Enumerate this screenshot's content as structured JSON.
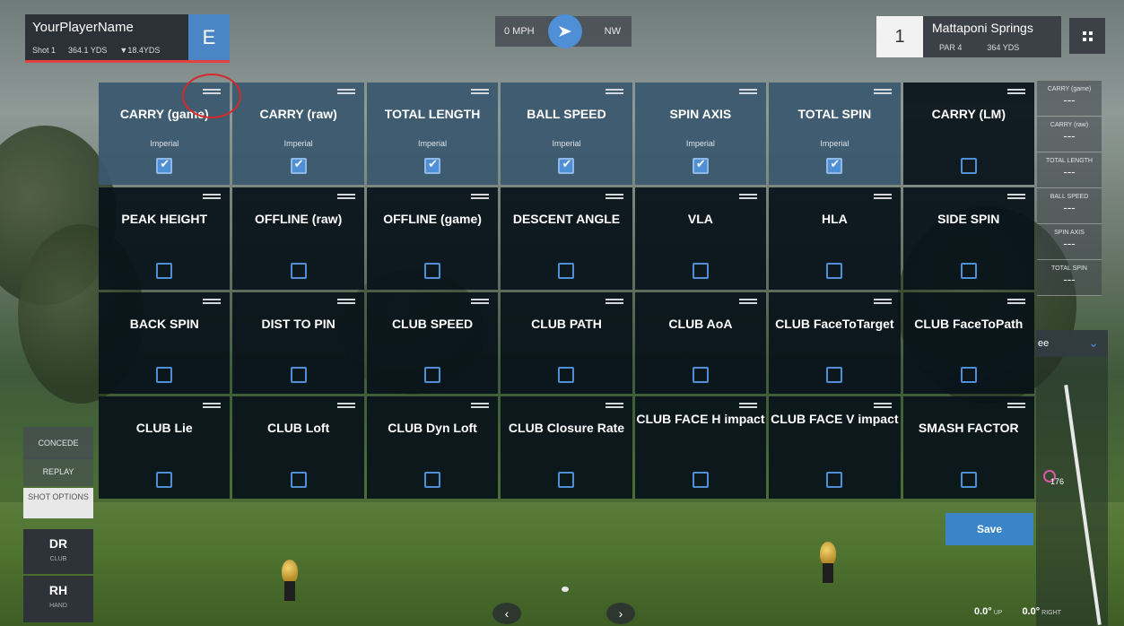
{
  "player": {
    "name": "YourPlayerName",
    "shot": "Shot 1",
    "distance": "364.1 YDS",
    "to_pin": "▼18.4YDS",
    "score": "E"
  },
  "wind": {
    "speed": "0 MPH",
    "direction": "NW"
  },
  "hole": {
    "number": "1",
    "course": "Mattaponi Springs",
    "par": "PAR 4",
    "yards": "364 YDS"
  },
  "stats": [
    {
      "label": "CARRY (game)",
      "value": "---"
    },
    {
      "label": "CARRY (raw)",
      "value": "---"
    },
    {
      "label": "TOTAL LENGTH",
      "value": "---"
    },
    {
      "label": "BALL SPEED",
      "value": "---"
    },
    {
      "label": "SPIN AXIS",
      "value": "---"
    },
    {
      "label": "TOTAL SPIN",
      "value": "---"
    }
  ],
  "tiles": [
    {
      "label": "CARRY (game)",
      "unit": "Imperial",
      "checked": true
    },
    {
      "label": "CARRY (raw)",
      "unit": "Imperial",
      "checked": true
    },
    {
      "label": "TOTAL LENGTH",
      "unit": "Imperial",
      "checked": true
    },
    {
      "label": "BALL SPEED",
      "unit": "Imperial",
      "checked": true
    },
    {
      "label": "SPIN AXIS",
      "unit": "Imperial",
      "checked": true
    },
    {
      "label": "TOTAL SPIN",
      "unit": "Imperial",
      "checked": true
    },
    {
      "label": "CARRY (LM)",
      "unit": "",
      "checked": false
    },
    {
      "label": "PEAK HEIGHT",
      "unit": "",
      "checked": false
    },
    {
      "label": "OFFLINE (raw)",
      "unit": "",
      "checked": false
    },
    {
      "label": "OFFLINE (game)",
      "unit": "",
      "checked": false
    },
    {
      "label": "DESCENT ANGLE",
      "unit": "",
      "checked": false
    },
    {
      "label": "VLA",
      "unit": "",
      "checked": false
    },
    {
      "label": "HLA",
      "unit": "",
      "checked": false
    },
    {
      "label": "SIDE SPIN",
      "unit": "",
      "checked": false
    },
    {
      "label": "BACK SPIN",
      "unit": "",
      "checked": false
    },
    {
      "label": "DIST TO PIN",
      "unit": "",
      "checked": false
    },
    {
      "label": "CLUB SPEED",
      "unit": "",
      "checked": false
    },
    {
      "label": "CLUB PATH",
      "unit": "",
      "checked": false
    },
    {
      "label": "CLUB AoA",
      "unit": "",
      "checked": false
    },
    {
      "label": "CLUB FaceToTarget",
      "unit": "",
      "checked": false
    },
    {
      "label": "CLUB FaceToPath",
      "unit": "",
      "checked": false
    },
    {
      "label": "CLUB Lie",
      "unit": "",
      "checked": false
    },
    {
      "label": "CLUB Loft",
      "unit": "",
      "checked": false
    },
    {
      "label": "CLUB Dyn Loft",
      "unit": "",
      "checked": false
    },
    {
      "label": "CLUB Closure Rate",
      "unit": "",
      "checked": false
    },
    {
      "label": "CLUB FACE H impact",
      "unit": "",
      "checked": false
    },
    {
      "label": "CLUB FACE V impact",
      "unit": "",
      "checked": false
    },
    {
      "label": "SMASH FACTOR",
      "unit": "",
      "checked": false
    }
  ],
  "side_panel": {
    "dropdown": "ee",
    "pin_distance": "176"
  },
  "buttons": {
    "concede": "CONCEDE",
    "replay": "REPLAY",
    "shot_options": "SHOT OPTIONS",
    "save": "Save"
  },
  "club": {
    "value": "DR",
    "label": "CLUB"
  },
  "hand": {
    "value": "RH",
    "label": "HAND"
  },
  "angles": {
    "up": "0.0°",
    "up_label": "UP",
    "right": "0.0°",
    "right_label": "RIGHT"
  },
  "colors": {
    "accent": "#4f8fd6",
    "score_bg": "#4a86c5",
    "underline": "#e1413f",
    "tile_checked": "#3a586e",
    "tile_unchecked": "#08121a"
  },
  "icons": {
    "wind_arrow": "navigation-arrow-icon",
    "menu": "grid-menu-icon",
    "checkbox_check": "check-icon",
    "drag": "drag-handle-icon"
  }
}
